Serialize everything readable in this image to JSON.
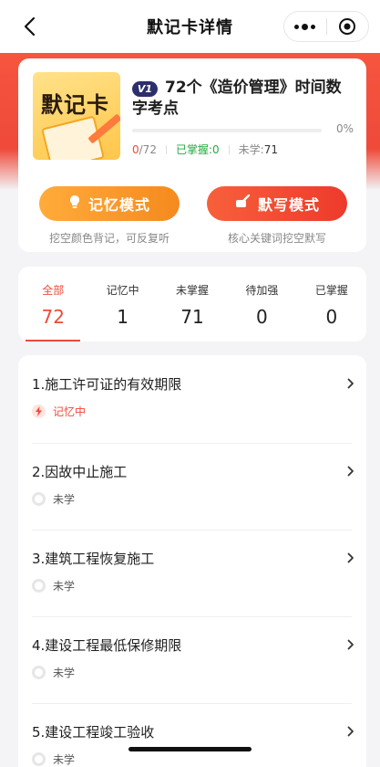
{
  "nav": {
    "title": "默记卡详情"
  },
  "card": {
    "cover_title": "默记卡",
    "version_badge": "V1",
    "title": "72个《造价管理》时间数字考点",
    "progress_percent_label": "0%",
    "progress_fraction": 0,
    "learned": "0",
    "total": "/72",
    "mastered_label": "已掌握:0",
    "unlearned_label": "未学:",
    "unlearned_count": "71"
  },
  "modes": {
    "memory": {
      "label": "记忆模式",
      "sub": "挖空颜色背记，可反复听"
    },
    "dictation": {
      "label": "默写模式",
      "sub": "核心关键词挖空默写"
    }
  },
  "tabs": [
    {
      "label": "全部",
      "count": "72"
    },
    {
      "label": "记忆中",
      "count": "1"
    },
    {
      "label": "未掌握",
      "count": "71"
    },
    {
      "label": "待加强",
      "count": "0"
    },
    {
      "label": "已掌握",
      "count": "0"
    }
  ],
  "items": [
    {
      "title": "1.施工许可证的有效期限",
      "status": "记忆中"
    },
    {
      "title": "2.因故中止施工",
      "status": "未学"
    },
    {
      "title": "3.建筑工程恢复施工",
      "status": "未学"
    },
    {
      "title": "4.建设工程最低保修期限",
      "status": "未学"
    },
    {
      "title": "5.建设工程竣工验收",
      "status": "未学"
    }
  ],
  "colors": {
    "accent": "#ef4a3a",
    "memory_btn": "#f7962a",
    "mastered": "#28a745"
  }
}
